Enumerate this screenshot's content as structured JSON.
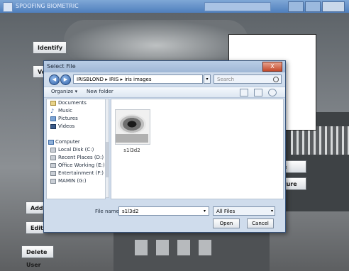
{
  "window": {
    "title": "SPOOFING BIOMETRIC"
  },
  "buttons": {
    "identify": "Identify",
    "verify": "Ve",
    "add": "Add",
    "edit": "Edit",
    "delete_user": "Delete User",
    "capture_partial": "re",
    "picture_partial": "cture"
  },
  "dialog": {
    "title": "Select File",
    "close_label": "X",
    "address": "IRISBLOND ▸ IRIS ▸ iris images",
    "search_placeholder": "Search",
    "toolbar": {
      "organize": "Organize ▾",
      "new_folder": "New folder"
    },
    "nav_items": [
      {
        "label": "Documents",
        "icon": "document-icon"
      },
      {
        "label": "Music",
        "icon": "music-icon"
      },
      {
        "label": "Pictures",
        "icon": "pictures-icon"
      },
      {
        "label": "Videos",
        "icon": "video-icon"
      },
      {
        "label": "Computer",
        "icon": "computer-icon"
      },
      {
        "label": "Local Disk (C:)",
        "icon": "drive-icon"
      },
      {
        "label": "Recent Places (D:)",
        "icon": "drive-icon"
      },
      {
        "label": "Office Working (E:)",
        "icon": "drive-icon"
      },
      {
        "label": "Entertainment (F:)",
        "icon": "drive-icon"
      },
      {
        "label": "MAMIN (G:)",
        "icon": "drive-icon"
      }
    ],
    "files": [
      {
        "name": "s1l3d2",
        "icon": "eye-image-icon"
      }
    ],
    "file_name_label": "File name:",
    "file_name_value": "s1l3d2",
    "file_type": "All Files",
    "open_button": "Open",
    "cancel_button": "Cancel"
  }
}
